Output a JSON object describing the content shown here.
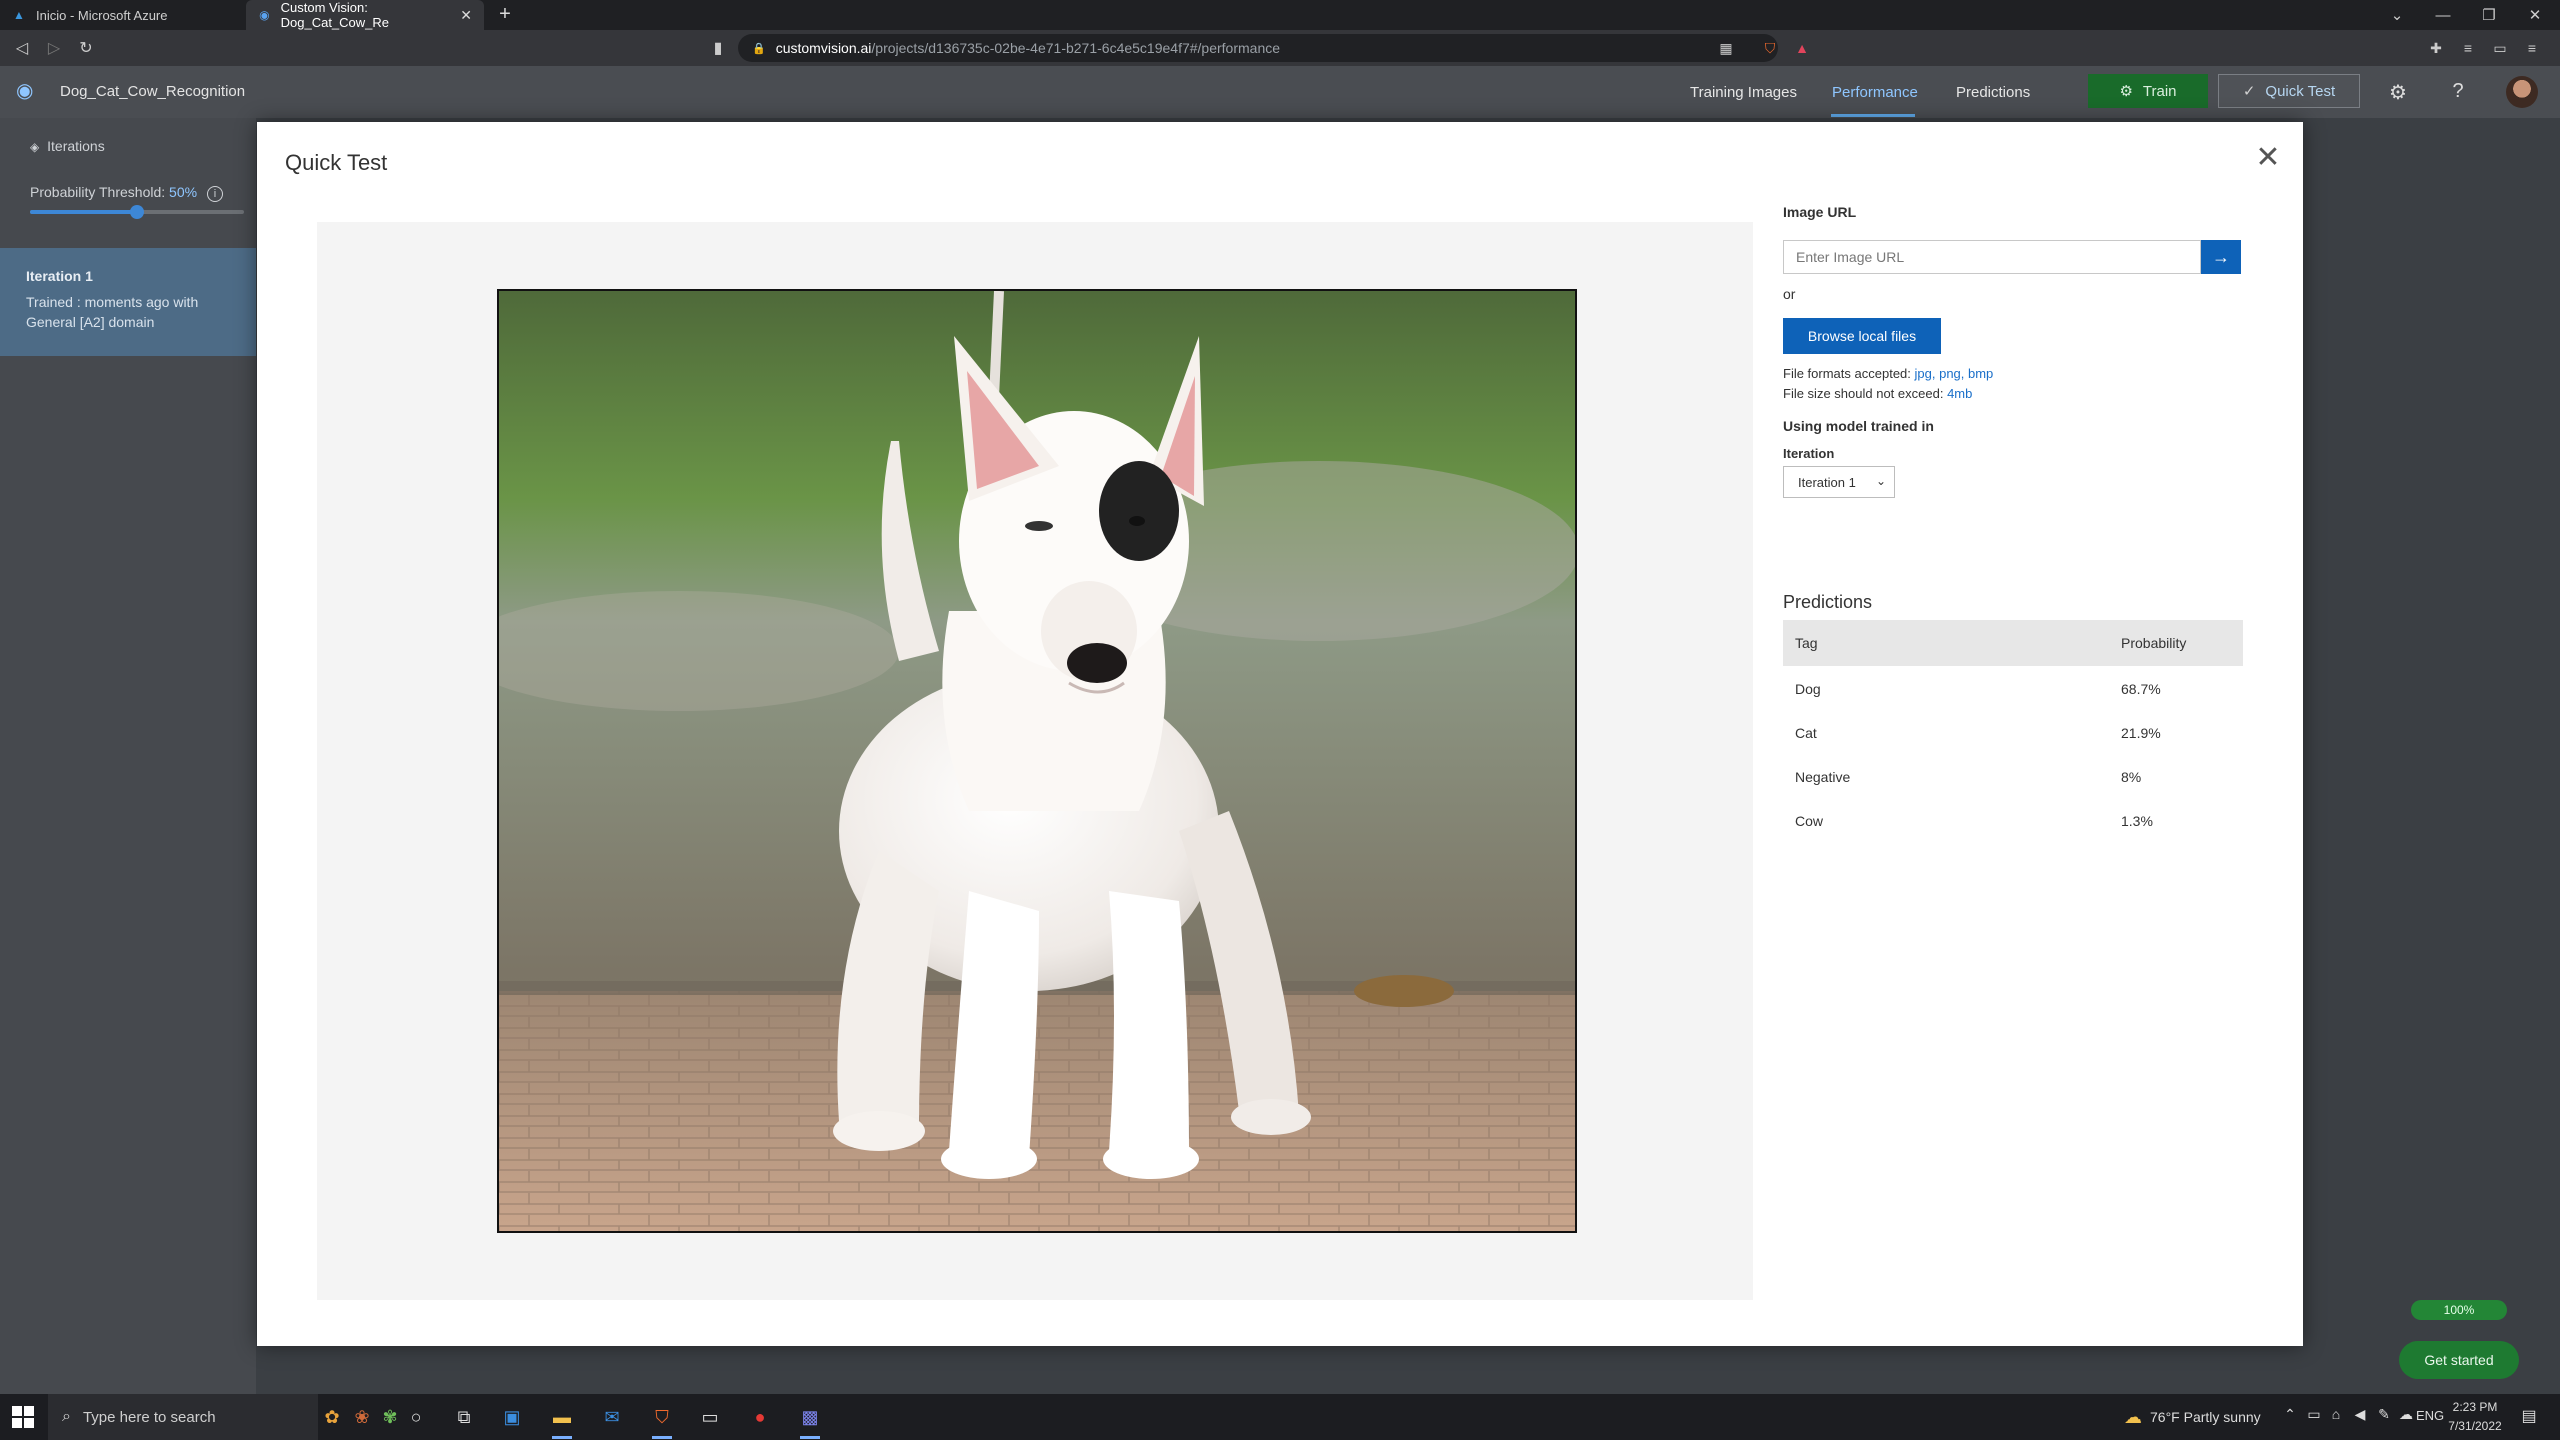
{
  "browser": {
    "tabs": [
      {
        "title": "Inicio - Microsoft Azure",
        "active": false
      },
      {
        "title": "Custom Vision: Dog_Cat_Cow_Re",
        "active": true
      }
    ],
    "url": {
      "host": "customvision.ai",
      "path": "/projects/d136735c-02be-4e71-b271-6c4e5c19e4f7#/performance"
    }
  },
  "header": {
    "project_name": "Dog_Cat_Cow_Recognition",
    "nav": [
      "Training Images",
      "Performance",
      "Predictions"
    ],
    "active_nav": "Performance",
    "train_label": "Train",
    "quick_test_label": "Quick Test"
  },
  "sidebar": {
    "iterations_label": "Iterations",
    "threshold_label": "Probability Threshold:",
    "threshold_value": "50%",
    "threshold_fraction": 0.5,
    "iteration": {
      "title": "Iteration 1",
      "subtitle": "Trained : moments ago with General [A2] domain"
    }
  },
  "modal": {
    "title": "Quick Test",
    "image_url_label": "Image URL",
    "image_url_placeholder": "Enter Image URL",
    "or_label": "or",
    "browse_label": "Browse local files",
    "formats_prefix": "File formats accepted:",
    "formats_value": "jpg, png, bmp",
    "size_prefix": "File size should not exceed:",
    "size_value": "4mb",
    "model_label": "Using model trained in",
    "iteration_label": "Iteration",
    "iteration_selected": "Iteration 1",
    "predictions_title": "Predictions",
    "predictions_headers": {
      "tag": "Tag",
      "probability": "Probability"
    },
    "predictions": [
      {
        "tag": "Dog",
        "probability": "68.7%"
      },
      {
        "tag": "Cat",
        "probability": "21.9%"
      },
      {
        "tag": "Negative",
        "probability": "8%"
      },
      {
        "tag": "Cow",
        "probability": "1.3%"
      }
    ]
  },
  "overlay": {
    "progress_label": "100%",
    "get_started_label": "Get started"
  },
  "taskbar": {
    "search_placeholder": "Type here to search",
    "weather": "76°F  Partly sunny",
    "language": "ENG",
    "time": "2:23 PM",
    "date": "7/31/2022"
  },
  "colors": {
    "accent": "#0e62b8",
    "train_green": "#196b2a",
    "nav_active": "#8fc6ff"
  }
}
